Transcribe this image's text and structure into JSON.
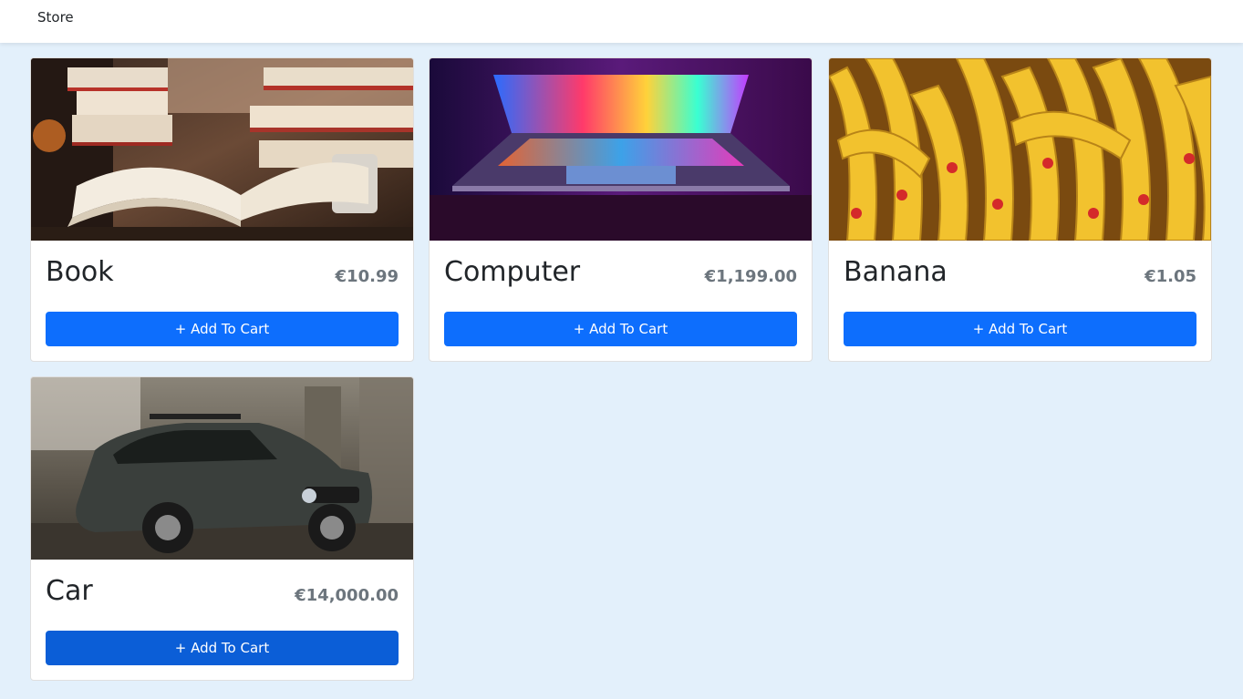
{
  "navbar": {
    "brand": "Store"
  },
  "products": [
    {
      "name": "Book",
      "price": "€10.99",
      "button": "+ Add To Cart",
      "image": "book-photo"
    },
    {
      "name": "Computer",
      "price": "€1,199.00",
      "button": "+ Add To Cart",
      "image": "laptop-photo"
    },
    {
      "name": "Banana",
      "price": "€1.05",
      "button": "+ Add To Cart",
      "image": "banana-photo"
    },
    {
      "name": "Car",
      "price": "€14,000.00",
      "button": "+ Add To Cart",
      "image": "car-photo"
    }
  ],
  "colors": {
    "page_bg": "#e3f0fb",
    "primary": "#0d6efd",
    "primary_hover": "#0b5ed7",
    "muted": "#6c757d"
  }
}
